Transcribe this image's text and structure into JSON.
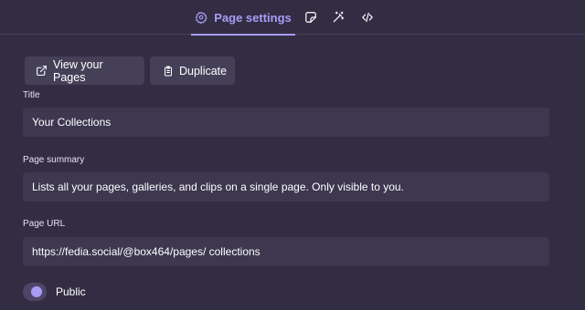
{
  "tabs": {
    "page_settings_label": "Page settings",
    "icons": [
      "gear-icon",
      "sticker-icon",
      "magic-wand-icon",
      "code-icon"
    ]
  },
  "actions": {
    "view_pages_label": "View your Pages",
    "duplicate_label": "Duplicate"
  },
  "form": {
    "title_label": "Title",
    "title_value": "Your Collections",
    "summary_label": "Page summary",
    "summary_value": "Lists all your pages, galleries, and clips on a single page. Only visible to you.",
    "url_label": "Page URL",
    "url_value": "https://fedia.social/@box464/pages/  collections",
    "public_label": "Public",
    "public_on": true
  },
  "colors": {
    "background": "#332d43",
    "accent": "#a99cf5",
    "input_bg": "#3d3750",
    "button_bg": "#454058"
  }
}
